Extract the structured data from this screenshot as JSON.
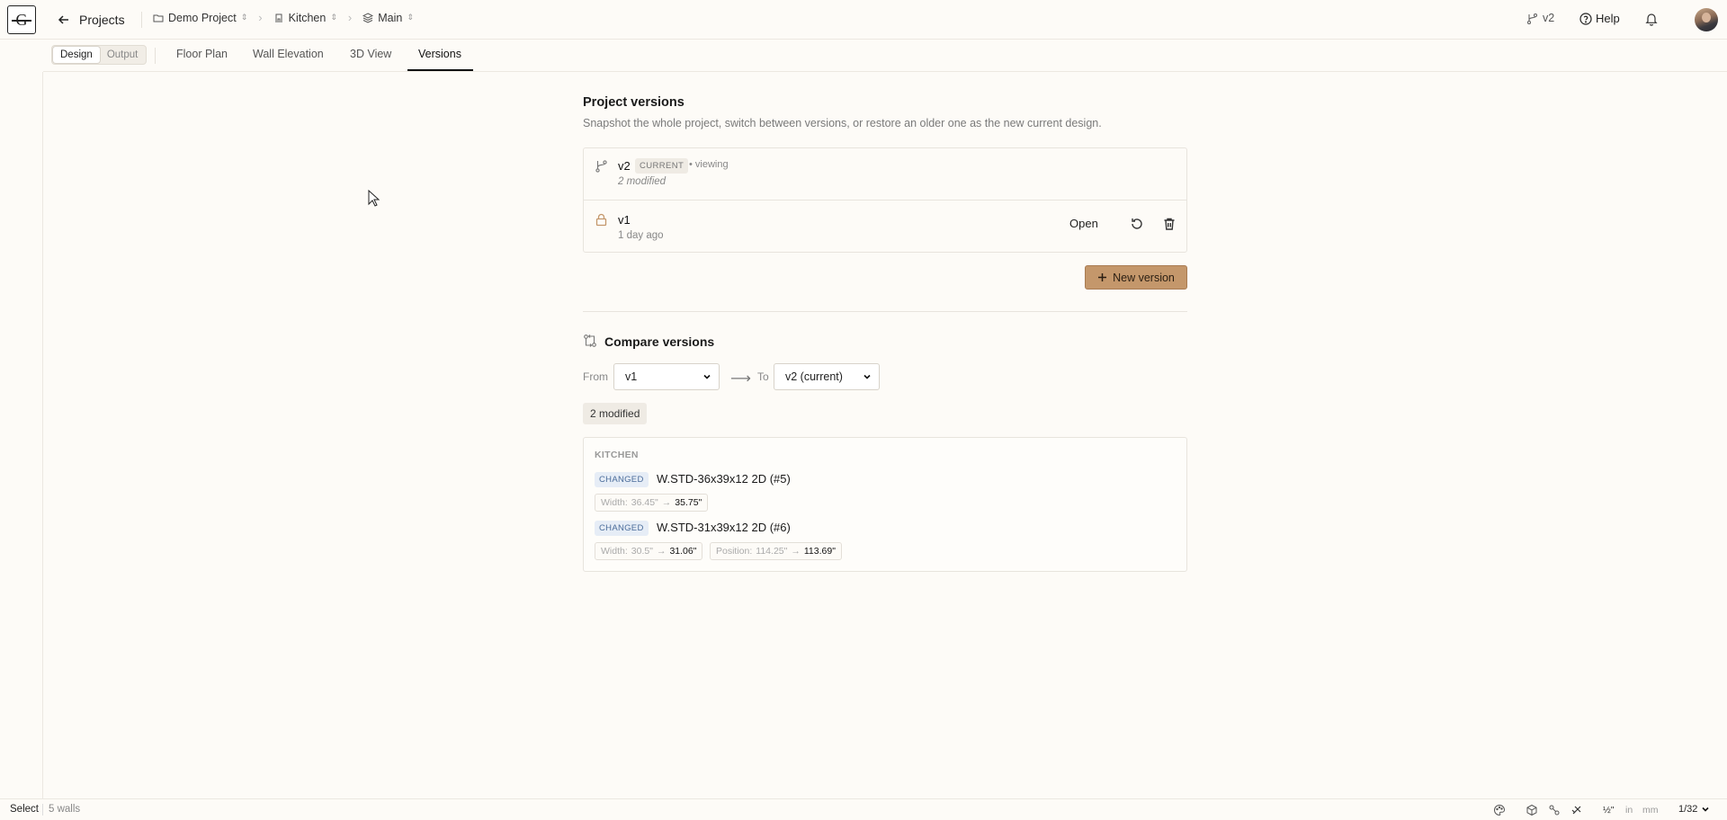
{
  "header": {
    "logo_text": "G",
    "back_label": "Projects",
    "breadcrumbs": [
      {
        "label": "Demo Project",
        "icon": "folder-icon"
      },
      {
        "label": "Kitchen",
        "icon": "room-icon"
      },
      {
        "label": "Main",
        "icon": "layers-icon"
      }
    ],
    "version_label": "v2",
    "help_label": "Help"
  },
  "toolbar": {
    "mode_design": "Design",
    "mode_output": "Output",
    "tabs": [
      "Floor Plan",
      "Wall Elevation",
      "3D View",
      "Versions"
    ],
    "active_tab": "Versions"
  },
  "versions": {
    "title": "Project versions",
    "subtitle": "Snapshot the whole project, switch between versions, or restore an older one as the new current design.",
    "list": [
      {
        "name": "v2",
        "badge": "CURRENT",
        "status": "• viewing",
        "meta": "2 modified"
      },
      {
        "name": "v1",
        "meta": "1 day ago",
        "open_label": "Open"
      }
    ],
    "new_button": "New version"
  },
  "compare": {
    "title": "Compare versions",
    "from_label": "From",
    "from_value": "v1",
    "arrow": "⟶",
    "to_label": "To",
    "to_value": "v2 (current)",
    "summary": "2 modified",
    "room": "KITCHEN",
    "changes": [
      {
        "tag": "CHANGED",
        "item": "W.STD-36x39x12 2D (#5)",
        "props": [
          {
            "label": "Width:",
            "old": "36.45\"",
            "new": "35.75\""
          }
        ]
      },
      {
        "tag": "CHANGED",
        "item": "W.STD-31x39x12 2D (#6)",
        "props": [
          {
            "label": "Width:",
            "old": "30.5\"",
            "new": "31.06\""
          },
          {
            "label": "Position:",
            "old": "114.25\"",
            "new": "113.69\""
          }
        ]
      }
    ]
  },
  "status": {
    "mode": "Select",
    "walls": "5 walls",
    "unit_in": "in",
    "unit_mm": "mm",
    "fraction": "½\"",
    "scale": "1/32"
  },
  "colors": {
    "accent_button": "#c4976b",
    "background": "#fdfbf7",
    "changed_tag": "#e6edf6"
  }
}
